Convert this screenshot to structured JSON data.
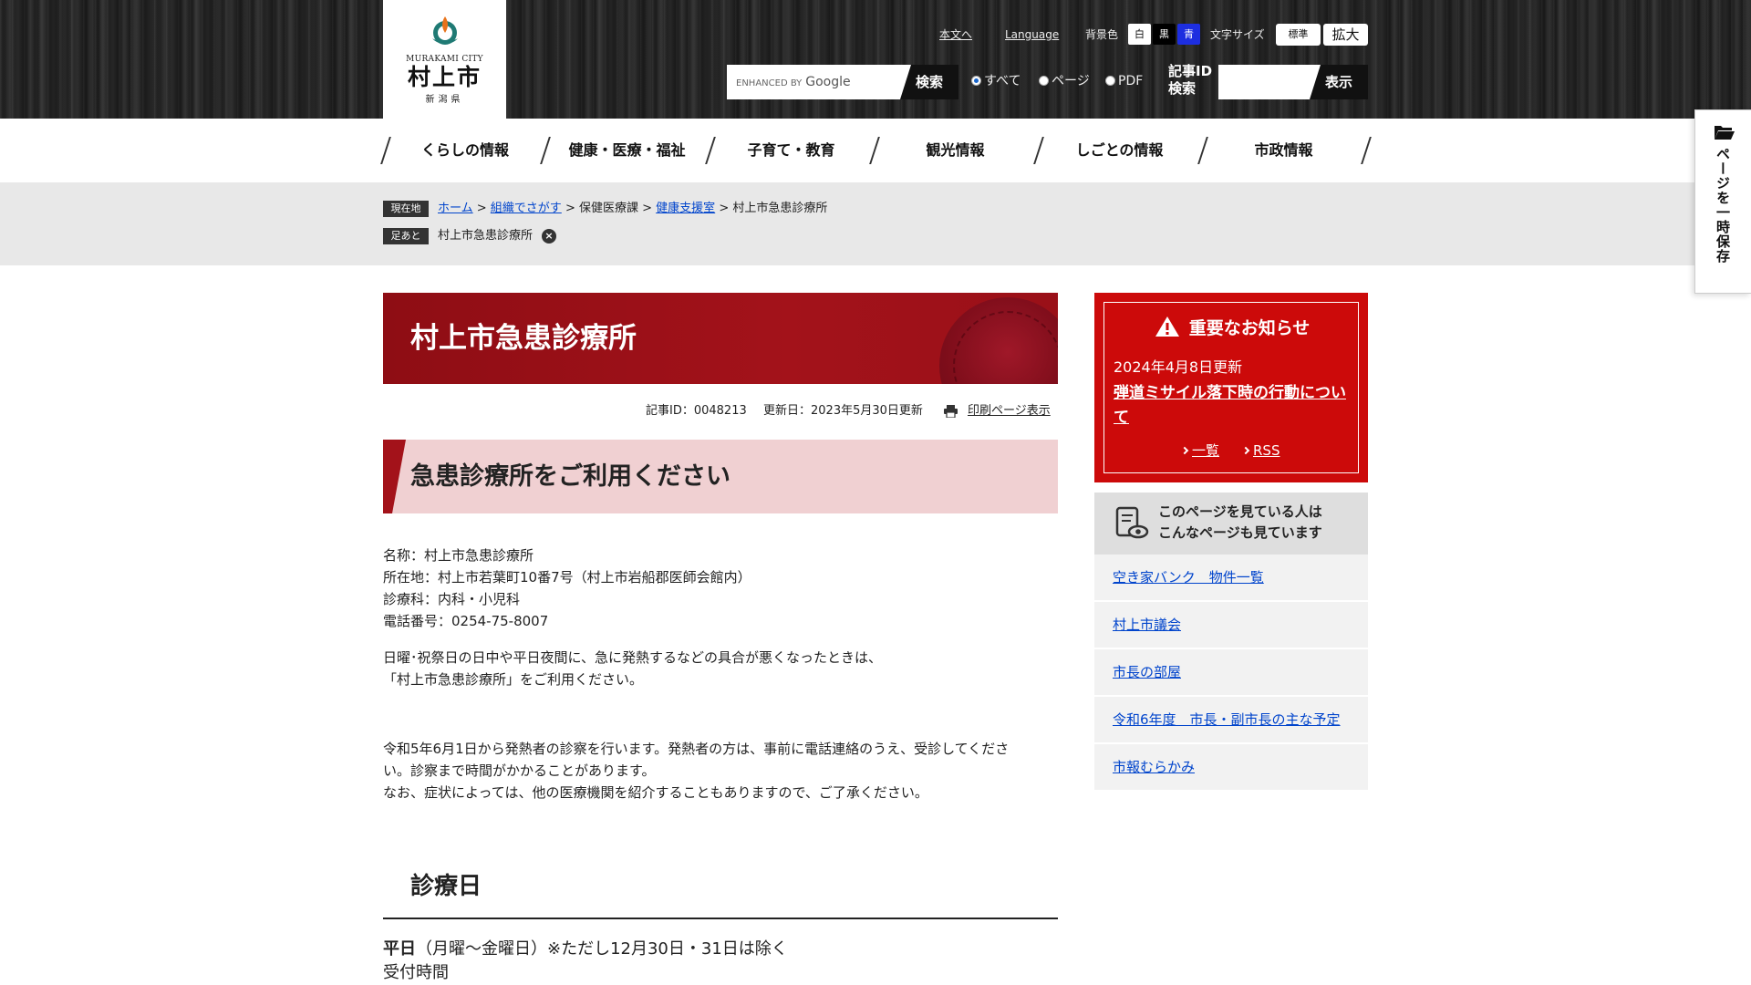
{
  "header": {
    "logo_en": "MURAKAMI CITY",
    "logo_ja": "村上市",
    "logo_pref": "新潟県",
    "skip_link": "本文へ",
    "language": "Language",
    "bg_label": "背景色",
    "bg_options": [
      "白",
      "黒",
      "青"
    ],
    "font_label": "文字サイズ",
    "font_standard": "標準",
    "font_large": "拡大",
    "search_placeholder_prefix": "ENHANCED BY",
    "search_placeholder_brand": "Google",
    "search_button": "検索",
    "radio_options": [
      "すべて",
      "ページ",
      "PDF"
    ],
    "id_search_label_1": "記事ID",
    "id_search_label_2": "検索",
    "id_search_button": "表示"
  },
  "nav": {
    "items": [
      "くらしの情報",
      "健康・医療・福祉",
      "子育て・教育",
      "観光情報",
      "しごとの情報",
      "市政情報"
    ]
  },
  "breadcrumb": {
    "current_tag": "現在地",
    "path": [
      {
        "label": "ホーム",
        "link": true
      },
      {
        "label": "組織でさがす",
        "link": true
      },
      {
        "label": "保健医療課",
        "link": false
      },
      {
        "label": "健康支援室",
        "link": true
      },
      {
        "label": "村上市急患診療所",
        "link": false
      }
    ],
    "footprint_tag": "足あと",
    "footprint_item": "村上市急患診療所"
  },
  "article": {
    "title": "村上市急患診療所",
    "article_id": "記事ID：0048213",
    "updated": "更新日：2023年5月30日更新",
    "print_link": "印刷ページ表示",
    "heading": "急患診療所をご利用ください",
    "info": [
      "名称：村上市急患診療所",
      "所在地：村上市若葉町10番7号（村上市岩船郡医師会館内）",
      "診療科：内科・小児科",
      "電話番号：0254-75-8007"
    ],
    "notice_lines": [
      "日曜･祝祭日の日中や平日夜間に、急に発熱するなどの具合が悪くなったときは、",
      "「村上市急患診療所」をご利用ください。"
    ],
    "fever_lines": [
      "令和5年6月1日から発熱者の診察を行います。発熱者の方は、事前に電話連絡のうえ、受診してくださ",
      "い。診察まで時間がかかることがあります。",
      "なお、症状によっては、他の医療機関を紹介することもありますので、ご了承ください。"
    ],
    "section_title": "診療日",
    "weekday_bold": "平日",
    "weekday_rest": "（月曜～金曜日）※ただし12月30日・31日は除く",
    "reception": "受付時間"
  },
  "sidebar": {
    "notice_title": "重要なお知らせ",
    "notice_date": "2024年4月8日更新",
    "notice_link": "弾道ミサイル落下時の行動について",
    "notice_list": "一覧",
    "notice_rss": "RSS",
    "related_title_1": "このページを見ている人は",
    "related_title_2": "こんなページも見ています",
    "related": [
      "空き家バンク　物件一覧",
      "村上市議会",
      "市長の部屋",
      "令和6年度　市長・副市長の主な予定",
      "市報むらかみ"
    ]
  },
  "side_tab": {
    "label": "ページを一時保存"
  },
  "colors": {
    "accent_red": "#a3121a",
    "notice_red": "#cc0a0a",
    "link_blue": "#0044cc",
    "heading_pink": "#f0d0d2"
  }
}
